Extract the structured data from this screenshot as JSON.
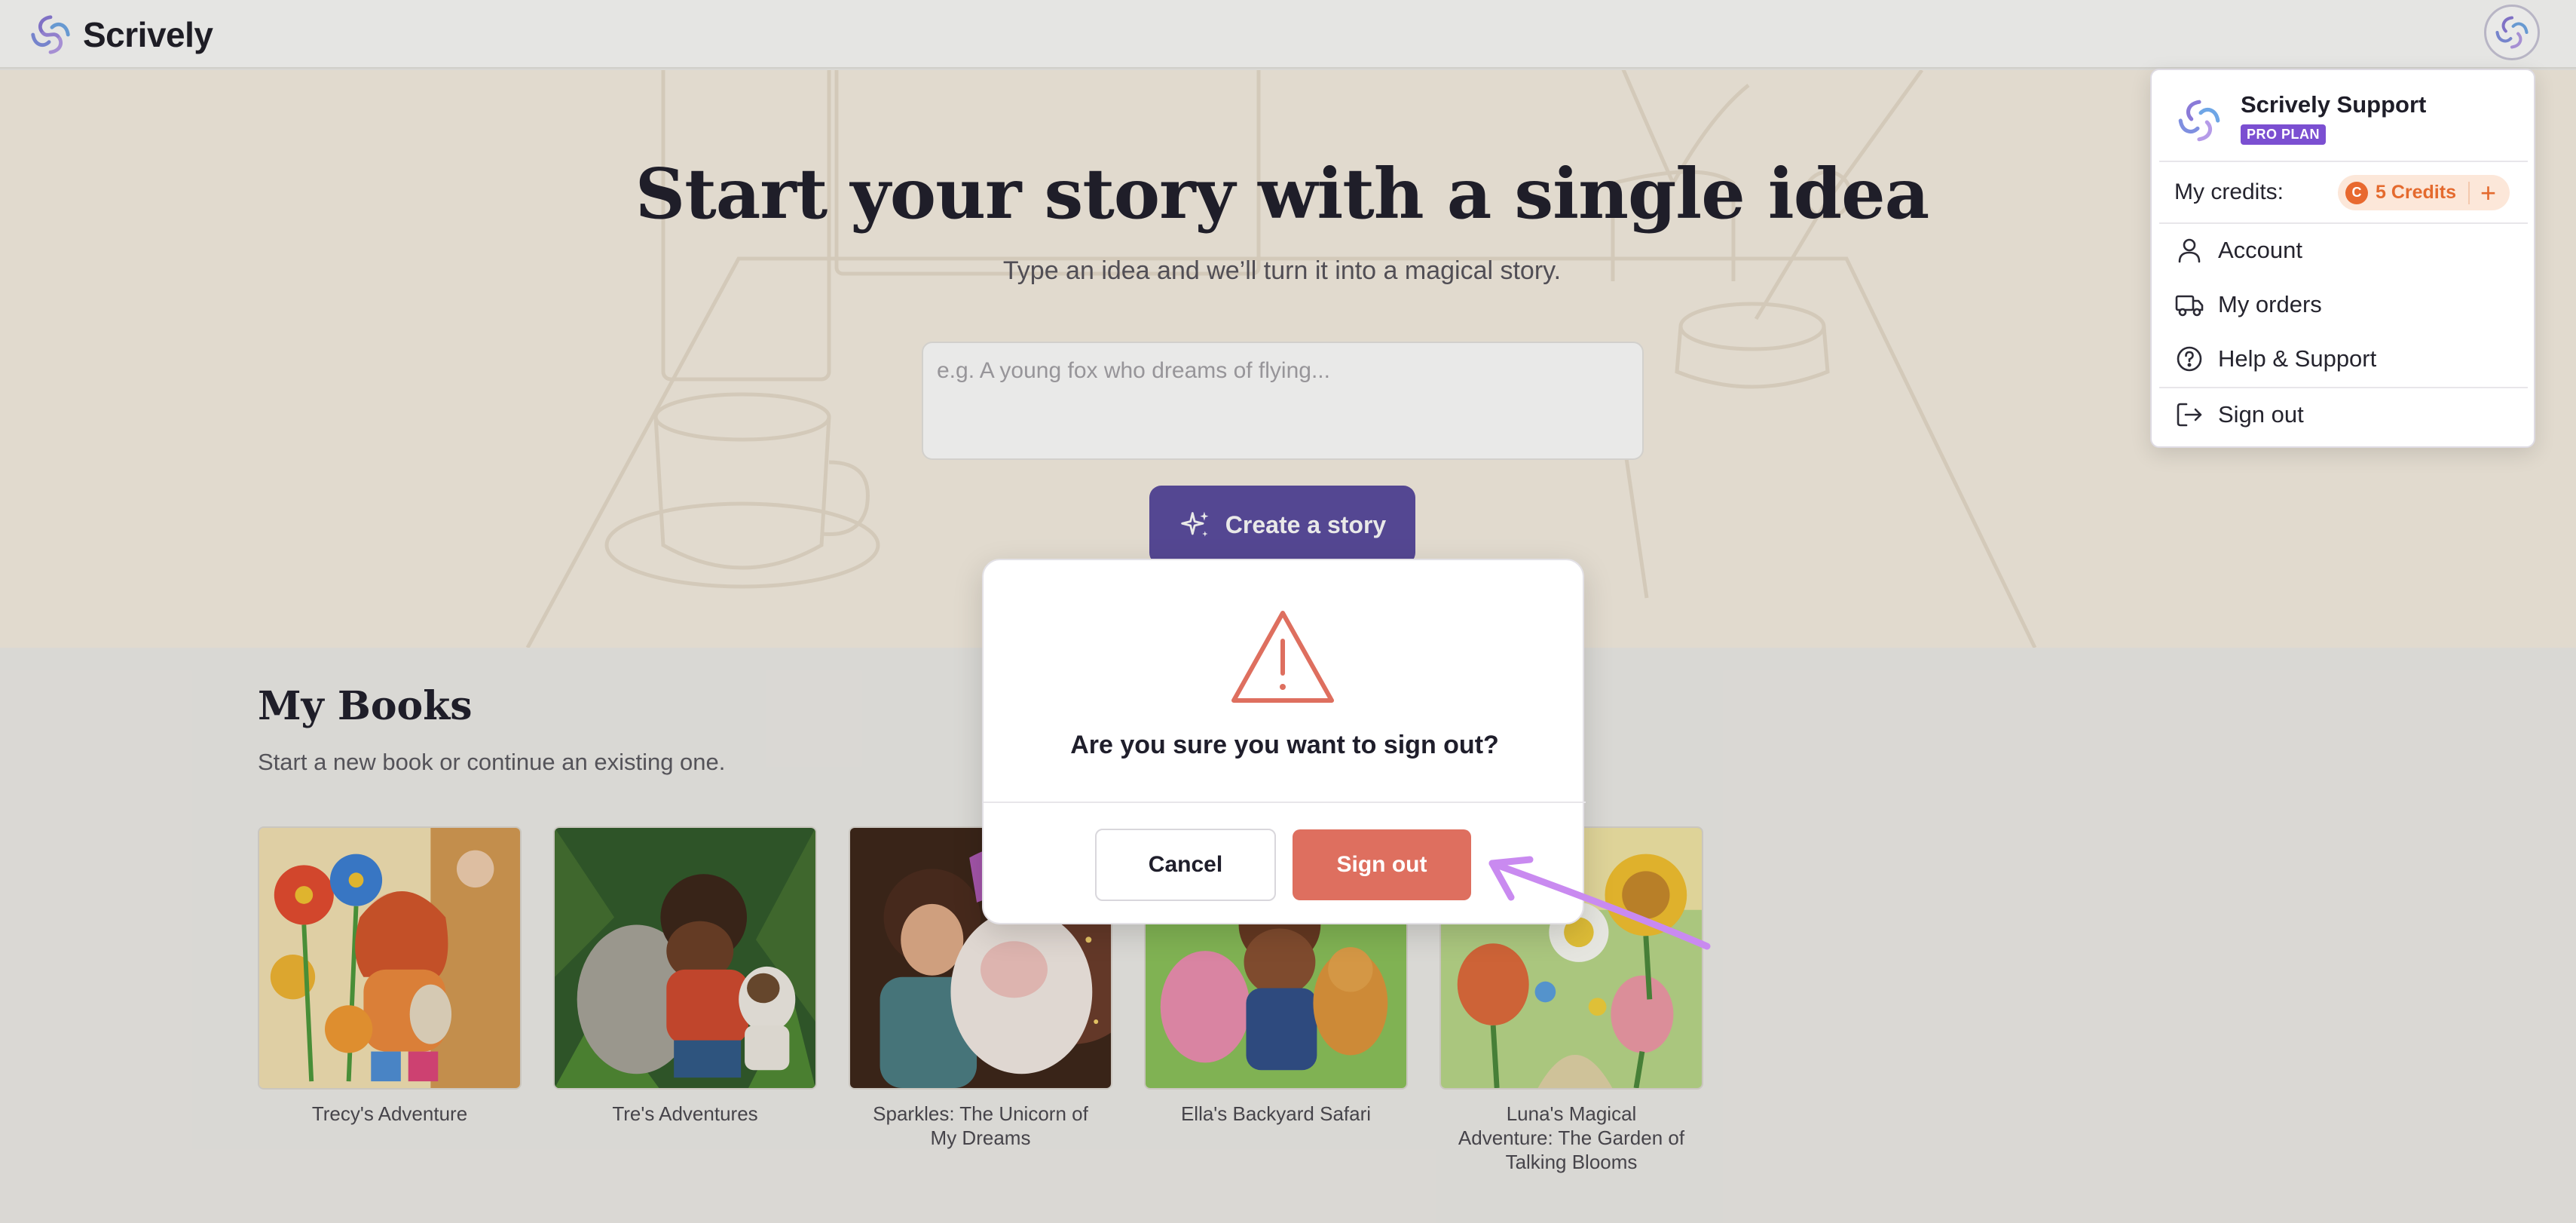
{
  "app": {
    "name": "Scrively"
  },
  "hero": {
    "title": "Start your story with a single idea",
    "subtitle": "Type an idea and we’ll turn it into a magical story.",
    "input_placeholder": "e.g. A young fox who dreams of flying...",
    "input_value": "",
    "create_button_label": "Create a story",
    "create_button_icon": "sparkles-icon"
  },
  "books": {
    "title": "My Books",
    "subtitle": "Start a new book or continue an existing one.",
    "items": [
      {
        "title": "Trecy's Adventure"
      },
      {
        "title": "Tre's Adventures"
      },
      {
        "title": "Sparkles: The Unicorn of My Dreams"
      },
      {
        "title": "Ella's Backyard Safari"
      },
      {
        "title": "Luna's Magical Adventure: The Garden of Talking Blooms"
      }
    ]
  },
  "user_menu": {
    "name": "Scrively Support",
    "plan": "PRO PLAN",
    "credits_label": "My credits:",
    "credits_value": "5 Credits",
    "credits_coin": "C",
    "credits_add": "+",
    "items": [
      {
        "label": "Account",
        "icon": "user-icon"
      },
      {
        "label": "My orders",
        "icon": "truck-icon"
      },
      {
        "label": "Help & Support",
        "icon": "help-circle-icon"
      },
      {
        "label": "Sign out",
        "icon": "sign-out-icon"
      }
    ]
  },
  "dialog": {
    "icon": "warning-triangle-icon",
    "question": "Are you sure you want to sign out?",
    "cancel_label": "Cancel",
    "confirm_label": "Sign out"
  },
  "colors": {
    "primary": "#5a4ba0",
    "danger": "#de6f5f",
    "plan_badge": "#7b4fd1",
    "credits_accent": "#e46a2e",
    "annotation_arrow": "#c98af0"
  }
}
